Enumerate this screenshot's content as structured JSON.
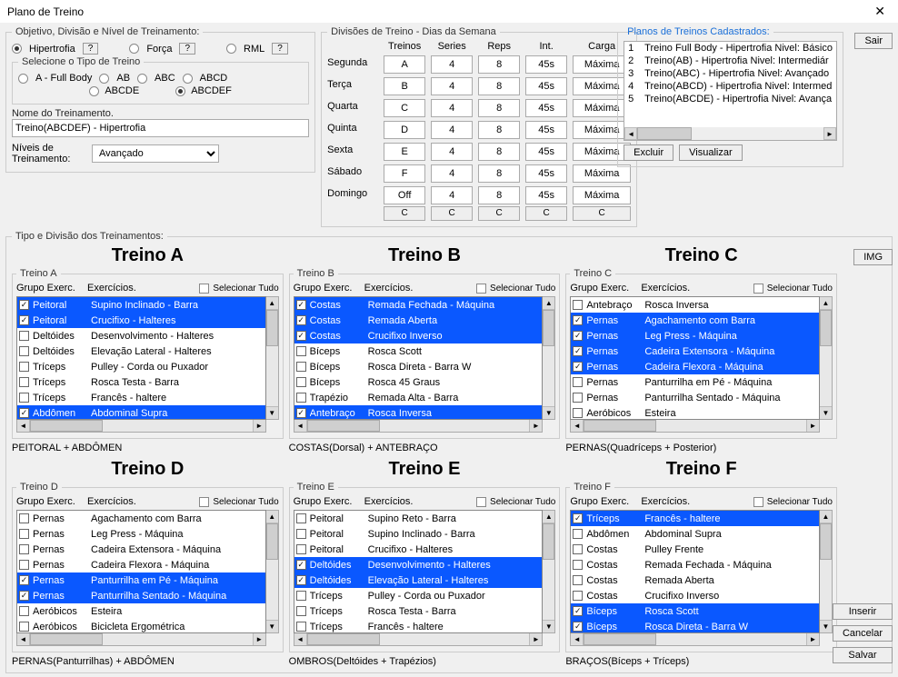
{
  "window": {
    "title": "Plano de Treino",
    "close": "✕"
  },
  "objective": {
    "legend": "Objetivo, Divisão e Nível de Treinamento:",
    "hipertrofia": "Hipertrofia",
    "forca": "Força",
    "rml": "RML",
    "q": "?",
    "tipo_legend": "Selecione o Tipo de Treino",
    "a": "A - Full Body",
    "ab": "AB",
    "abc": "ABC",
    "abcd": "ABCD",
    "abcde": "ABCDE",
    "abcdef": "ABCDEF",
    "nome_label": "Nome do Treinamento.",
    "nome_value": "Treino(ABCDEF) - Hipertrofia",
    "nivel_label": "Níveis de Treinamento:",
    "nivel_value": "Avançado"
  },
  "week": {
    "legend": "Divisões de Treino - Dias da Semana",
    "h_treinos": "Treinos",
    "h_series": "Series",
    "h_reps": "Reps",
    "h_int": "Int.",
    "h_carga": "Carga",
    "days": [
      {
        "day": "Segunda",
        "t": "A",
        "s": "4",
        "r": "8",
        "i": "45s",
        "c": "Máxima"
      },
      {
        "day": "Terça",
        "t": "B",
        "s": "4",
        "r": "8",
        "i": "45s",
        "c": "Máxima"
      },
      {
        "day": "Quarta",
        "t": "C",
        "s": "4",
        "r": "8",
        "i": "45s",
        "c": "Máxima"
      },
      {
        "day": "Quinta",
        "t": "D",
        "s": "4",
        "r": "8",
        "i": "45s",
        "c": "Máxima"
      },
      {
        "day": "Sexta",
        "t": "E",
        "s": "4",
        "r": "8",
        "i": "45s",
        "c": "Máxima"
      },
      {
        "day": "Sábado",
        "t": "F",
        "s": "4",
        "r": "8",
        "i": "45s",
        "c": "Máxima"
      },
      {
        "day": "Domingo",
        "t": "Off",
        "s": "4",
        "r": "8",
        "i": "45s",
        "c": "Máxima"
      }
    ],
    "compact": [
      "",
      "C",
      "C",
      "C",
      "C",
      "C"
    ]
  },
  "plans": {
    "legend": "Planos de Treinos Cadastrados:",
    "rows": [
      {
        "n": "1",
        "t": "Treino Full Body - Hipertrofia Nivel: Básico"
      },
      {
        "n": "2",
        "t": "Treino(AB) - Hipertrofia Nivel: Intermediár"
      },
      {
        "n": "3",
        "t": "Treino(ABC) - Hipertrofia Nivel: Avançado"
      },
      {
        "n": "4",
        "t": "Treino(ABCD) - Hipertrofia Nivel: Intermed"
      },
      {
        "n": "5",
        "t": "Treino(ABCDE) - Hipertrofia Nivel: Avança"
      }
    ],
    "excluir": "Excluir",
    "visualizar": "Visualizar"
  },
  "buttons": {
    "sair": "Sair",
    "img": "IMG",
    "inserir": "Inserir",
    "cancelar": "Cancelar",
    "salvar": "Salvar"
  },
  "section_legend": "Tipo e Divisão dos Treinamentos:",
  "labels": {
    "grupo": "Grupo Exerc.",
    "exerc": "Exercícios.",
    "sel_all": "Selecionar Tudo"
  },
  "trainings": [
    {
      "title": "Treino A",
      "legend": "Treino A",
      "summary": "PEITORAL + ABDÔMEN",
      "rows": [
        {
          "g": "Peitoral",
          "e": "Supino Inclinado - Barra",
          "c": true,
          "s": true
        },
        {
          "g": "Peitoral",
          "e": "Crucifixo - Halteres",
          "c": true,
          "s": true
        },
        {
          "g": "Deltóides",
          "e": "Desenvolvimento - Halteres",
          "c": false,
          "s": false
        },
        {
          "g": "Deltóides",
          "e": "Elevação Lateral - Halteres",
          "c": false,
          "s": false
        },
        {
          "g": "Tríceps",
          "e": "Pulley - Corda ou Puxador",
          "c": false,
          "s": false
        },
        {
          "g": "Tríceps",
          "e": "Rosca Testa - Barra",
          "c": false,
          "s": false
        },
        {
          "g": "Tríceps",
          "e": "Francês - haltere",
          "c": false,
          "s": false
        },
        {
          "g": "Abdômen",
          "e": "Abdominal Supra",
          "c": true,
          "s": true
        }
      ]
    },
    {
      "title": "Treino B",
      "legend": "Treino B",
      "summary": "COSTAS(Dorsal) + ANTEBRAÇO",
      "rows": [
        {
          "g": "Costas",
          "e": "Remada Fechada - Máquina",
          "c": true,
          "s": true
        },
        {
          "g": "Costas",
          "e": "Remada Aberta",
          "c": true,
          "s": true
        },
        {
          "g": "Costas",
          "e": "Crucifixo Inverso",
          "c": true,
          "s": true
        },
        {
          "g": "Bíceps",
          "e": "Rosca Scott",
          "c": false,
          "s": false
        },
        {
          "g": "Bíceps",
          "e": "Rosca Direta - Barra W",
          "c": false,
          "s": false
        },
        {
          "g": "Bíceps",
          "e": "Rosca 45 Graus",
          "c": false,
          "s": false
        },
        {
          "g": "Trapézio",
          "e": "Remada Alta - Barra",
          "c": false,
          "s": false
        },
        {
          "g": "Antebraço",
          "e": "Rosca Inversa",
          "c": true,
          "s": true
        }
      ]
    },
    {
      "title": "Treino C",
      "legend": "Treino C",
      "summary": "PERNAS(Quadríceps + Posterior)",
      "rows": [
        {
          "g": "Antebraço",
          "e": "Rosca Inversa",
          "c": false,
          "s": false
        },
        {
          "g": "Pernas",
          "e": "Agachamento com Barra",
          "c": true,
          "s": true
        },
        {
          "g": "Pernas",
          "e": "Leg Press - Máquina",
          "c": true,
          "s": true
        },
        {
          "g": "Pernas",
          "e": "Cadeira Extensora - Máquina",
          "c": true,
          "s": true
        },
        {
          "g": "Pernas",
          "e": "Cadeira Flexora - Máquina",
          "c": true,
          "s": true
        },
        {
          "g": "Pernas",
          "e": "Panturrilha em Pé - Máquina",
          "c": false,
          "s": false
        },
        {
          "g": "Pernas",
          "e": "Panturrilha Sentado - Máquina",
          "c": false,
          "s": false
        },
        {
          "g": "Aeróbicos",
          "e": "Esteira",
          "c": false,
          "s": false
        }
      ]
    },
    {
      "title": "Treino D",
      "legend": "Treino D",
      "summary": "PERNAS(Panturrilhas) + ABDÔMEN",
      "rows": [
        {
          "g": "Pernas",
          "e": "Agachamento com Barra",
          "c": false,
          "s": false
        },
        {
          "g": "Pernas",
          "e": "Leg Press - Máquina",
          "c": false,
          "s": false
        },
        {
          "g": "Pernas",
          "e": "Cadeira Extensora - Máquina",
          "c": false,
          "s": false
        },
        {
          "g": "Pernas",
          "e": "Cadeira Flexora - Máquina",
          "c": false,
          "s": false
        },
        {
          "g": "Pernas",
          "e": "Panturrilha em Pé - Máquina",
          "c": true,
          "s": true
        },
        {
          "g": "Pernas",
          "e": "Panturrilha Sentado - Máquina",
          "c": true,
          "s": true
        },
        {
          "g": "Aeróbicos",
          "e": "Esteira",
          "c": false,
          "s": false
        },
        {
          "g": "Aeróbicos",
          "e": "Bicicleta Ergométrica",
          "c": false,
          "s": false
        }
      ]
    },
    {
      "title": "Treino E",
      "legend": "Treino E",
      "summary": "OMBROS(Deltóides + Trapézios)",
      "rows": [
        {
          "g": "Peitoral",
          "e": "Supino Reto - Barra",
          "c": false,
          "s": false
        },
        {
          "g": "Peitoral",
          "e": "Supino Inclinado - Barra",
          "c": false,
          "s": false
        },
        {
          "g": "Peitoral",
          "e": "Crucifixo - Halteres",
          "c": false,
          "s": false
        },
        {
          "g": "Deltóides",
          "e": "Desenvolvimento - Halteres",
          "c": true,
          "s": true
        },
        {
          "g": "Deltóides",
          "e": "Elevação Lateral - Halteres",
          "c": true,
          "s": true
        },
        {
          "g": "Tríceps",
          "e": "Pulley - Corda ou Puxador",
          "c": false,
          "s": false
        },
        {
          "g": "Tríceps",
          "e": "Rosca Testa - Barra",
          "c": false,
          "s": false
        },
        {
          "g": "Tríceps",
          "e": "Francês - haltere",
          "c": false,
          "s": false
        }
      ]
    },
    {
      "title": "Treino F",
      "legend": "Treino F",
      "summary": "BRAÇOS(Bíceps + Tríceps)",
      "rows": [
        {
          "g": "Tríceps",
          "e": "Francês - haltere",
          "c": true,
          "s": true
        },
        {
          "g": "Abdômen",
          "e": "Abdominal Supra",
          "c": false,
          "s": false
        },
        {
          "g": "Costas",
          "e": "Pulley Frente",
          "c": false,
          "s": false
        },
        {
          "g": "Costas",
          "e": "Remada Fechada - Máquina",
          "c": false,
          "s": false
        },
        {
          "g": "Costas",
          "e": "Remada Aberta",
          "c": false,
          "s": false
        },
        {
          "g": "Costas",
          "e": "Crucifixo Inverso",
          "c": false,
          "s": false
        },
        {
          "g": "Bíceps",
          "e": "Rosca Scott",
          "c": true,
          "s": true
        },
        {
          "g": "Bíceps",
          "e": "Rosca Direta - Barra W",
          "c": true,
          "s": true
        }
      ]
    }
  ]
}
